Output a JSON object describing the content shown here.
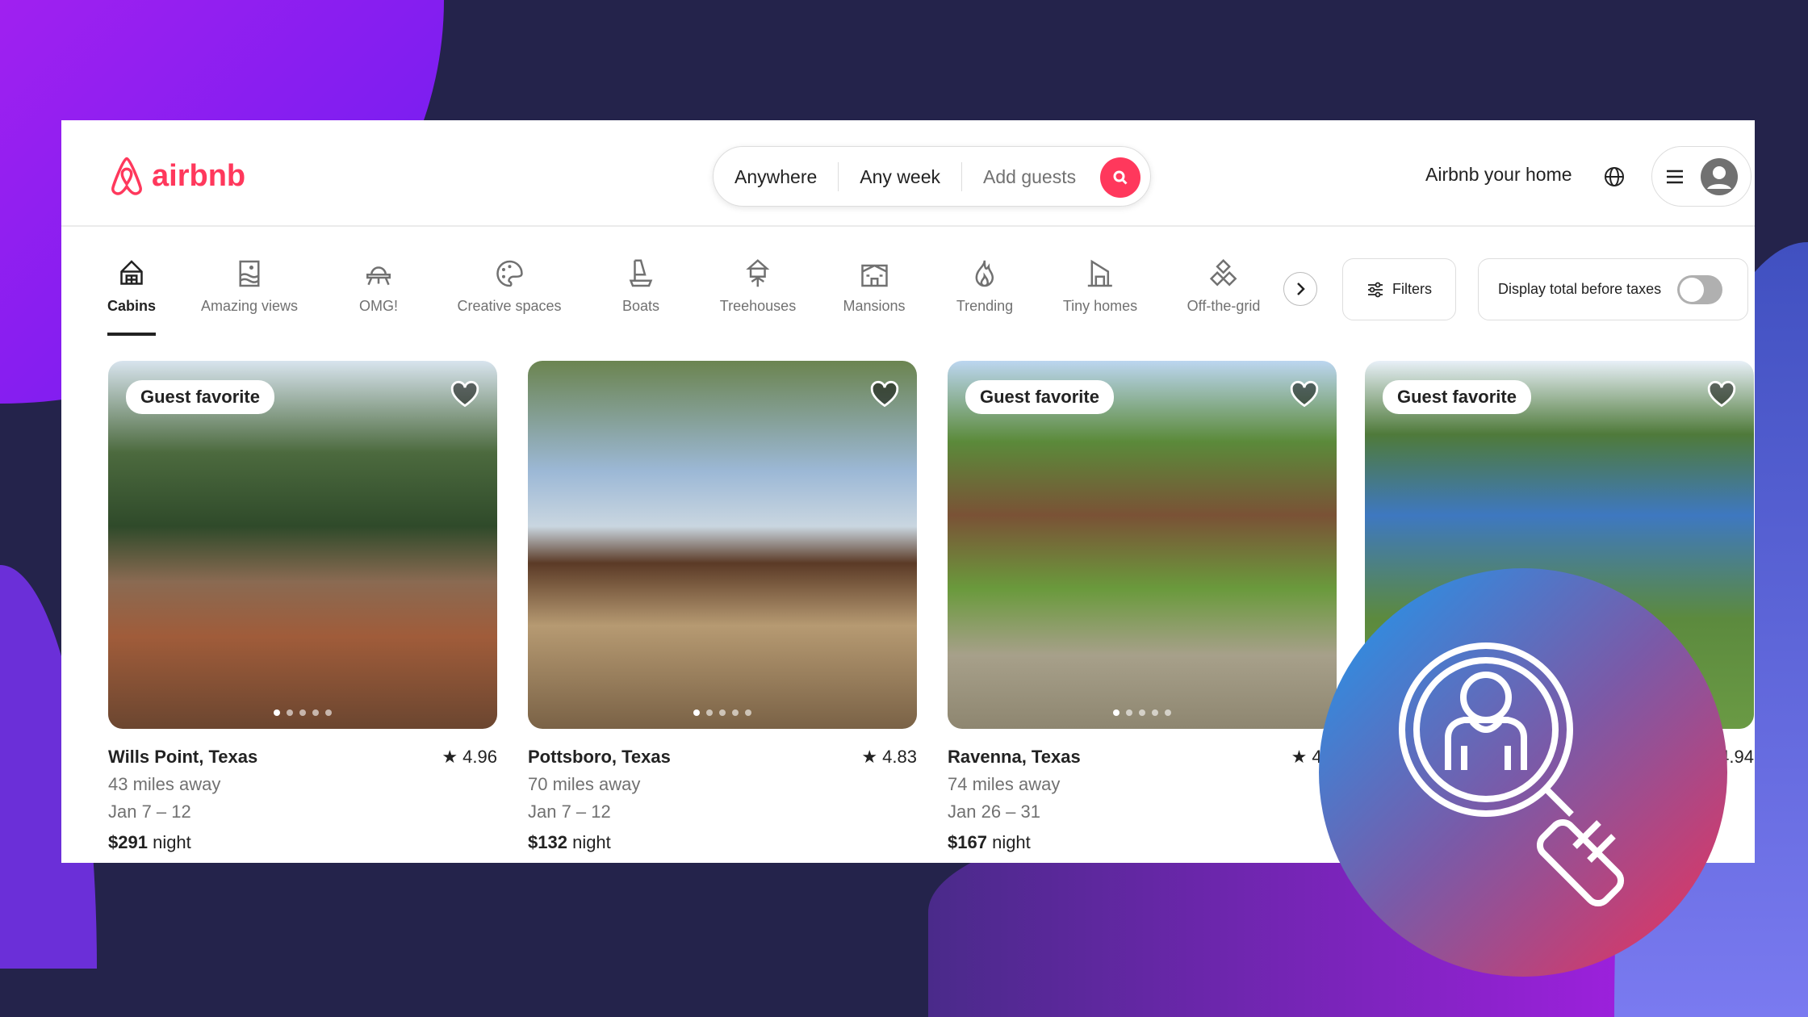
{
  "brand": {
    "name": "airbnb",
    "color": "#ff385c"
  },
  "search": {
    "location": "Anywhere",
    "dates": "Any week",
    "guests_placeholder": "Add guests"
  },
  "header": {
    "host_link": "Airbnb your home"
  },
  "categories": [
    {
      "label": "Cabins",
      "icon": "cabin-icon",
      "active": true
    },
    {
      "label": "Amazing views",
      "icon": "view-icon"
    },
    {
      "label": "OMG!",
      "icon": "ufo-icon"
    },
    {
      "label": "Creative spaces",
      "icon": "palette-icon"
    },
    {
      "label": "Boats",
      "icon": "boat-icon"
    },
    {
      "label": "Treehouses",
      "icon": "treehouse-icon"
    },
    {
      "label": "Mansions",
      "icon": "mansion-icon"
    },
    {
      "label": "Trending",
      "icon": "flame-icon"
    },
    {
      "label": "Tiny homes",
      "icon": "tiny-home-icon"
    },
    {
      "label": "Off-the-grid",
      "icon": "off-grid-icon"
    }
  ],
  "filters": {
    "label": "Filters",
    "taxes_label": "Display total before taxes",
    "taxes_on": false
  },
  "listings": [
    {
      "badge": "Guest favorite",
      "location": "Wills Point, Texas",
      "rating": "4.96",
      "distance": "43 miles away",
      "dates": "Jan 7 – 12",
      "price": "$291",
      "unit": "night"
    },
    {
      "badge": "",
      "location": "Pottsboro, Texas",
      "rating": "4.83",
      "distance": "70 miles away",
      "dates": "Jan 7 – 12",
      "price": "$132",
      "unit": "night"
    },
    {
      "badge": "Guest favorite",
      "location": "Ravenna, Texas",
      "rating": "4.9",
      "distance": "74 miles away",
      "dates": "Jan 26 – 31",
      "price": "$167",
      "unit": "night"
    },
    {
      "badge": "Guest favorite",
      "location": "",
      "rating": "4.94",
      "distance": "",
      "dates": "",
      "price": "",
      "unit": ""
    }
  ]
}
